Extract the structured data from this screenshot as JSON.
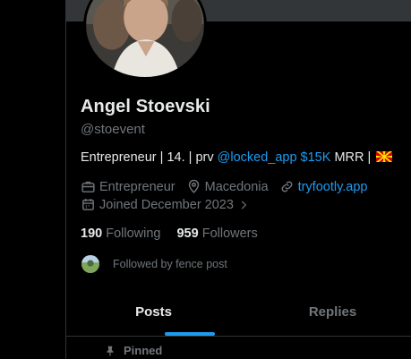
{
  "profile": {
    "name": "Angel Stoevski",
    "handle": "@stoevent",
    "bio": {
      "prefix": "Entrepreneur | 14. | prv ",
      "link_handle": "@locked_app",
      "mrr_value": " $15K",
      "suffix": " MRR | "
    },
    "category": "Entrepreneur",
    "location": "Macedonia",
    "website": "tryfootly.app",
    "joined": "Joined December 2023"
  },
  "stats": {
    "following_count": "190",
    "following_label": "Following",
    "followers_count": "959",
    "followers_label": "Followers"
  },
  "followed_by": "Followed by fence post",
  "tabs": [
    {
      "label": "Posts",
      "active": true
    },
    {
      "label": "Replies",
      "active": false
    }
  ],
  "pinned_label": "Pinned",
  "colors": {
    "accent": "#1d9bf0",
    "muted": "#71767b",
    "text": "#e7e9ea",
    "background": "#000000"
  }
}
